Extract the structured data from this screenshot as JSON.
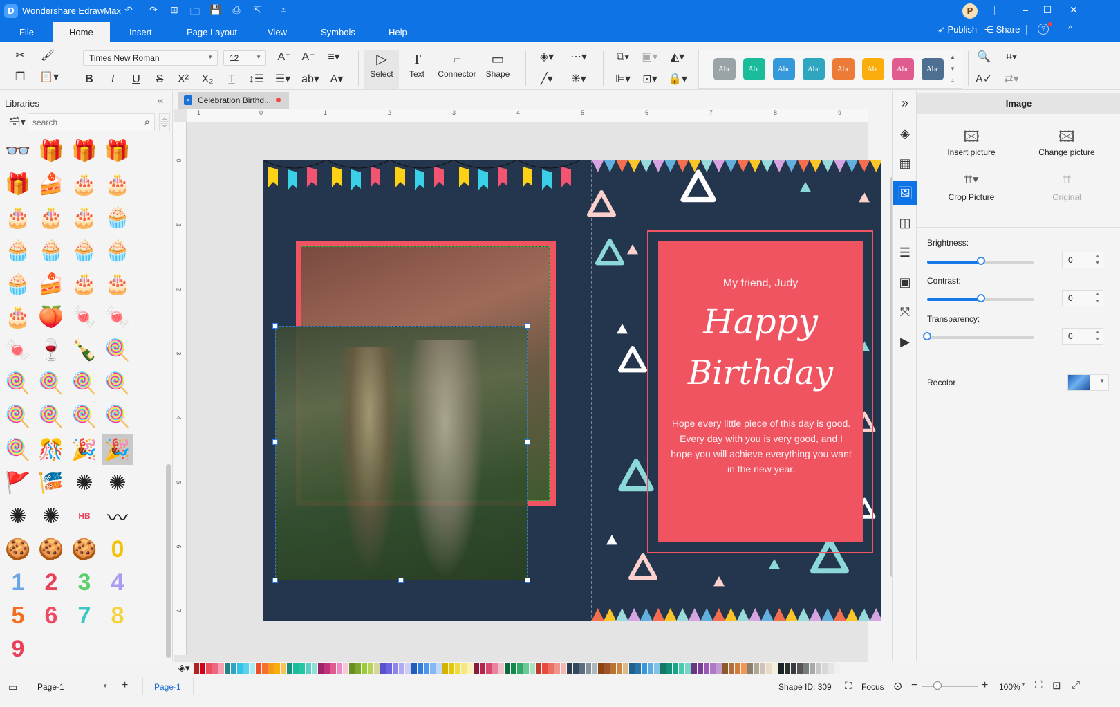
{
  "app": {
    "title": "Wondershare EdrawMax",
    "logo": "D"
  },
  "quick_access": [
    {
      "name": "undo-icon",
      "glyph": "↶"
    },
    {
      "name": "redo-icon",
      "glyph": "↷"
    },
    {
      "name": "new-icon",
      "glyph": "⊞"
    },
    {
      "name": "open-icon",
      "glyph": "🗀"
    },
    {
      "name": "save-icon",
      "glyph": "💾"
    },
    {
      "name": "print-icon",
      "glyph": "⎙"
    },
    {
      "name": "export-icon",
      "glyph": "⇱"
    },
    {
      "name": "customize-icon",
      "glyph": "⩡"
    }
  ],
  "user": {
    "avatar": "P"
  },
  "window_controls": {
    "minimize": "–",
    "maximize": "☐",
    "close": "✕"
  },
  "menu": {
    "items": [
      "File",
      "Home",
      "Insert",
      "Page Layout",
      "View",
      "Symbols",
      "Help"
    ],
    "active": "Home",
    "publish": "Publish",
    "share": "Share",
    "help_glyph": "?",
    "collapse_glyph": "^"
  },
  "ribbon": {
    "font_family": "Times New Roman",
    "font_size": "12",
    "tools": [
      {
        "label": "Select",
        "glyph": "▷"
      },
      {
        "label": "Text",
        "glyph": "T"
      },
      {
        "label": "Connector",
        "glyph": "⌐"
      },
      {
        "label": "Shape",
        "glyph": "▭"
      }
    ],
    "styles": [
      {
        "label": "Abc",
        "color": "#9aa3a6"
      },
      {
        "label": "Abc",
        "color": "#1abc9c"
      },
      {
        "label": "Abc",
        "color": "#3498db"
      },
      {
        "label": "Abc",
        "color": "#2fa6c0"
      },
      {
        "label": "Abc",
        "color": "#ed7b38"
      },
      {
        "label": "Abc",
        "color": "#fbad0b"
      },
      {
        "label": "Abc",
        "color": "#e05c8f"
      },
      {
        "label": "Abc",
        "color": "#4d6f91"
      }
    ]
  },
  "libraries": {
    "title": "Libraries",
    "search_placeholder": "search",
    "items": [
      "👓",
      "🎁",
      "🎁",
      "🎁",
      "🎁",
      "🍰",
      "🎂",
      "🎂",
      "🎂",
      "🎂",
      "🎂",
      "🧁",
      "🧁",
      "🧁",
      "🧁",
      "🧁",
      "🧁",
      "🍰",
      "🎂",
      "🎂",
      "🎂",
      "🍑",
      "🍬",
      "🍬",
      "🍬",
      "🍷",
      "🍾",
      "🍭",
      "🍭",
      "🍭",
      "🍭",
      "🍭",
      "🍭",
      "🍭",
      "🍭",
      "🍭",
      "🍭",
      "🎊",
      "🎉",
      "🎉",
      "🚩",
      "🎏",
      "✺",
      "✺",
      "✺",
      "✺",
      "HB",
      "〰",
      "🍪",
      "🍪",
      "🍪",
      "0",
      "1",
      "2",
      "3",
      "4",
      "5",
      "6",
      "7",
      "8",
      "9"
    ],
    "selected_index": 39
  },
  "document": {
    "tab_title": "Celebration Birthd...",
    "unsaved": true
  },
  "ruler": {
    "top": [
      "-1",
      "0",
      "1",
      "2",
      "3",
      "4",
      "5",
      "6",
      "7",
      "8",
      "9"
    ],
    "left": [
      "0",
      "1",
      "2",
      "3",
      "4",
      "5",
      "6",
      "7"
    ]
  },
  "card": {
    "greeting": "My friend, Judy",
    "line1": "Happy",
    "line2": "Birthday",
    "message_1": "Hope every little piece of this day is good.",
    "message_2": "Every day with you is very good, and I hope you will achieve everything you want in the new year.",
    "colors": {
      "background": "#24364e",
      "panel": "#f05461",
      "frame": "#f05461"
    }
  },
  "right_toolbar": [
    {
      "name": "expand-icon",
      "glyph": "»"
    },
    {
      "name": "fill-icon",
      "glyph": "◈"
    },
    {
      "name": "grid-icon",
      "glyph": "▦"
    },
    {
      "name": "image-icon",
      "glyph": "🖼",
      "active": true
    },
    {
      "name": "layers-icon",
      "glyph": "◫"
    },
    {
      "name": "page-icon",
      "glyph": "☰"
    },
    {
      "name": "group-icon",
      "glyph": "▣"
    },
    {
      "name": "connector-icon",
      "glyph": "⤧"
    },
    {
      "name": "presentation-icon",
      "glyph": "▶"
    }
  ],
  "image_panel": {
    "title": "Image",
    "insert_picture": "Insert picture",
    "change_picture": "Change picture",
    "crop_picture": "Crop Picture",
    "original": "Original",
    "brightness_label": "Brightness:",
    "brightness": 0,
    "contrast_label": "Contrast:",
    "contrast": 0,
    "transparency_label": "Transparency:",
    "transparency": 0,
    "recolor_label": "Recolor"
  },
  "palette": [
    "#b22222",
    "#d0021b",
    "#e8505b",
    "#f06680",
    "#f7a1b0",
    "#238484",
    "#2fa6c0",
    "#35c4e6",
    "#58d3ee",
    "#a7ecf5",
    "#f04e2b",
    "#f87030",
    "#f59b1b",
    "#fbad0b",
    "#f9c35a",
    "#14907d",
    "#1abc9c",
    "#26c6a0",
    "#59cfc4",
    "#8ce0d8",
    "#9b2366",
    "#c2317f",
    "#e05c8f",
    "#ec8ac1",
    "#f6c6dc",
    "#6b8e23",
    "#7ca82b",
    "#9acd32",
    "#b5d25b",
    "#d6d899",
    "#5a4fcf",
    "#6e63e0",
    "#8e84ee",
    "#b1a9f4",
    "#d0cbf8",
    "#1f5fb8",
    "#2e7de0",
    "#4d96f0",
    "#86b8f6",
    "#bdd8fa",
    "#d4b300",
    "#e6c800",
    "#f0dc3c",
    "#f5e87e",
    "#f9f2b8",
    "#8c1a3a",
    "#b5244d",
    "#d84b6f",
    "#e884a0",
    "#f2bfcf",
    "#0b6b3a",
    "#138a4d",
    "#33a86b",
    "#6cc896",
    "#a8e2c3",
    "#c0392b",
    "#e74c3c",
    "#ec7063",
    "#f1948a",
    "#f5b7b1",
    "#2c3e50",
    "#34495e",
    "#5d6d7e",
    "#85929e",
    "#aeb6bf",
    "#8b4513",
    "#a0522d",
    "#b87333",
    "#cd853f",
    "#deb887",
    "#1f618d",
    "#2874a6",
    "#3498db",
    "#5dade2",
    "#85c1e9",
    "#117a65",
    "#148f77",
    "#17a589",
    "#48c9b0",
    "#76d7c4",
    "#6c3483",
    "#7d3c98",
    "#9b59b6",
    "#af7ac5",
    "#c39bd3",
    "#8b5a2b",
    "#b06e3f",
    "#d27d3a",
    "#f4965a",
    "#8a8070",
    "#b0a890",
    "#d0c0b8",
    "#e6dcc8",
    "#f5f0dc",
    "#1a2428",
    "#2a3328",
    "#3a3a40",
    "#555555",
    "#777d78",
    "#a8a8a8",
    "#c8c8c8",
    "#d8d8d8",
    "#e5e5e5",
    "#f0f0f0"
  ],
  "status": {
    "page_select": "Page-1",
    "page_tab": "Page-1",
    "shape_id": "Shape ID: 309",
    "focus": "Focus",
    "zoom": "100%"
  }
}
